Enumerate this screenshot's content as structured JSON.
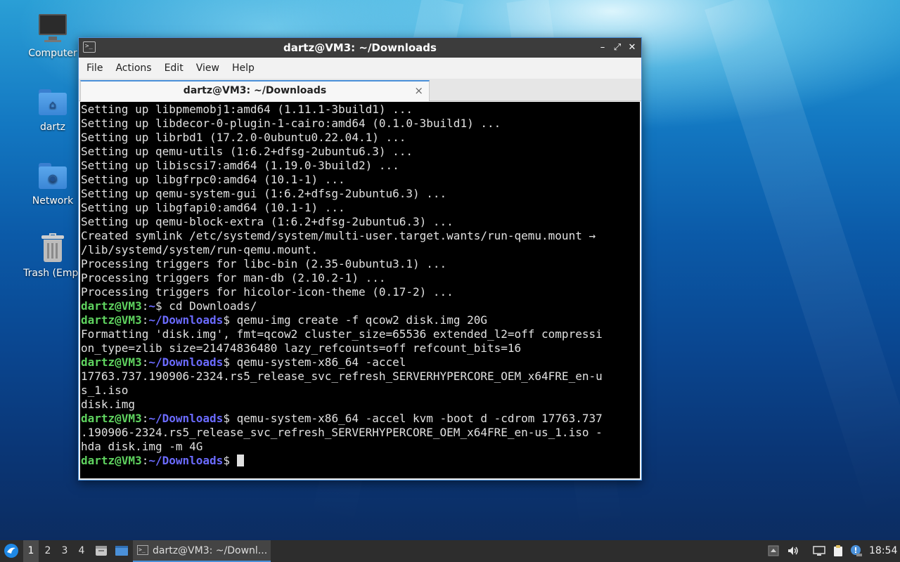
{
  "desktop": {
    "icons": [
      {
        "label": "Computer",
        "icon": "computer-icon"
      },
      {
        "label": "dartz",
        "icon": "home-folder-icon"
      },
      {
        "label": "Network",
        "icon": "network-folder-icon"
      },
      {
        "label": "Trash (Empt",
        "icon": "trash-icon"
      }
    ]
  },
  "window": {
    "title": "dartz@VM3: ~/Downloads",
    "controls": {
      "minimize": "–",
      "maximize": "⤢",
      "close": "✕"
    },
    "menu": [
      "File",
      "Actions",
      "Edit",
      "View",
      "Help"
    ],
    "tab": {
      "label": "dartz@VM3: ~/Downloads",
      "close": "×"
    }
  },
  "terminal": {
    "user_host": "dartz@VM3",
    "lines": [
      "Setting up libpmemobj1:amd64 (1.11.1-3build1) ...",
      "Setting up libdecor-0-plugin-1-cairo:amd64 (0.1.0-3build1) ...",
      "Setting up librbd1 (17.2.0-0ubuntu0.22.04.1) ...",
      "Setting up qemu-utils (1:6.2+dfsg-2ubuntu6.3) ...",
      "Setting up libiscsi7:amd64 (1.19.0-3build2) ...",
      "Setting up libgfrpc0:amd64 (10.1-1) ...",
      "Setting up qemu-system-gui (1:6.2+dfsg-2ubuntu6.3) ...",
      "Setting up libgfapi0:amd64 (10.1-1) ...",
      "Setting up qemu-block-extra (1:6.2+dfsg-2ubuntu6.3) ...",
      "Created symlink /etc/systemd/system/multi-user.target.wants/run-qemu.mount →",
      "/lib/systemd/system/run-qemu.mount.",
      "Processing triggers for libc-bin (2.35-0ubuntu3.1) ...",
      "Processing triggers for man-db (2.10.2-1) ...",
      "Processing triggers for hicolor-icon-theme (0.17-2) ..."
    ],
    "session": [
      {
        "path": ":~",
        "cmd": "$ cd Downloads/",
        "output": []
      },
      {
        "path": ":~/Downloads",
        "cmd": "$ qemu-img create -f qcow2 disk.img 20G",
        "output": [
          "Formatting 'disk.img', fmt=qcow2 cluster_size=65536 extended_l2=off compressi",
          "on_type=zlib size=21474836480 lazy_refcounts=off refcount_bits=16"
        ]
      },
      {
        "path": ":~/Downloads",
        "cmd": "$ qemu-system-x86_64 -accel",
        "output": [
          "17763.737.190906-2324.rs5_release_svc_refresh_SERVERHYPERCORE_OEM_x64FRE_en-u",
          "s_1.iso",
          "disk.img"
        ]
      },
      {
        "path": ":~/Downloads",
        "cmd": "$ qemu-system-x86_64 -accel kvm -boot d -cdrom 17763.737",
        "output": [
          ".190906-2324.rs5_release_svc_refresh_SERVERHYPERCORE_OEM_x64FRE_en-us_1.iso -",
          "hda disk.img -m 4G"
        ]
      }
    ],
    "prompt": {
      "path": ":~/Downloads",
      "symbol": "$ "
    }
  },
  "taskbar": {
    "workspaces": [
      "1",
      "2",
      "3",
      "4"
    ],
    "active_workspace": "1",
    "task_label": "dartz@VM3: ~/Downl...",
    "clock": "18:54"
  }
}
